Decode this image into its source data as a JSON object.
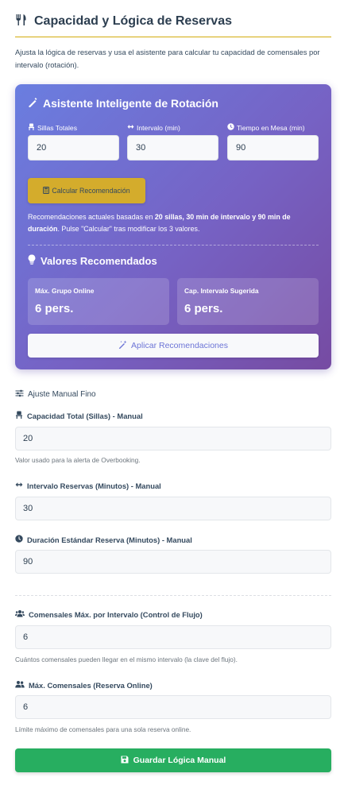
{
  "header": {
    "title": "Capacidad y Lógica de Reservas",
    "title_icon": "utensils-icon",
    "description": "Ajusta la lógica de reservas y usa el asistente para calcular tu capacidad de comensales por intervalo (rotación)."
  },
  "assistant": {
    "title": "Asistente Inteligente de Rotación",
    "title_icon": "magic-wand-icon",
    "fields": [
      {
        "label": "Sillas Totales",
        "icon": "chair-icon",
        "value": "20"
      },
      {
        "label": "Intervalo (min)",
        "icon": "arrows-h-icon",
        "value": "30"
      },
      {
        "label": "Tiempo en Mesa (min)",
        "icon": "clock-icon",
        "value": "90"
      }
    ],
    "calculate_button": "Calcular Recomendación",
    "calculate_icon": "calculator-icon",
    "recommendation": {
      "prefix": "Recomendaciones actuales basadas en ",
      "chairs": "20 sillas",
      "sep1": ", ",
      "interval": "30 min de intervalo",
      "sep2": " y ",
      "duration": "90 min de duración",
      "suffix": ". Pulse \"Calcular\" tras modificar los 3 valores."
    },
    "recommended_title": "Valores Recomendados",
    "recommended_icon": "lightbulb-icon",
    "recommended": [
      {
        "label": "Máx. Grupo Online",
        "value": "6 pers."
      },
      {
        "label": "Cap. Intervalo Sugerida",
        "value": "6 pers."
      }
    ],
    "apply_button": "Aplicar Recomendaciones",
    "apply_icon": "magic-icon"
  },
  "manual": {
    "heading": "Ajuste Manual Fino",
    "heading_icon": "sliders-icon",
    "fields": [
      {
        "label": "Capacidad Total (Sillas) - Manual",
        "icon": "chair-icon",
        "value": "20",
        "help": "Valor usado para la alerta de Overbooking."
      },
      {
        "label": "Intervalo Reservas (Minutos) - Manual",
        "icon": "arrows-h-icon",
        "value": "30",
        "help": ""
      },
      {
        "label": "Duración Estándar Reserva (Minutos) - Manual",
        "icon": "clock-icon",
        "value": "90",
        "help": ""
      },
      {
        "label": "Comensales Máx. por Intervalo (Control de Flujo)",
        "icon": "users-icon",
        "value": "6",
        "help": "Cuántos comensales pueden llegar en el mismo intervalo (la clave del flujo)."
      },
      {
        "label": "Máx. Comensales (Reserva Online)",
        "icon": "user-friends-icon",
        "value": "6",
        "help": "Límite máximo de comensales para una sola reserva online."
      }
    ],
    "save_button": "Guardar Lógica Manual",
    "save_icon": "save-icon"
  },
  "colors": {
    "accent_gold": "#d4ac0d",
    "gradient_start": "#6a7ee0",
    "gradient_end": "#764ba2",
    "save_green": "#27ae60"
  }
}
